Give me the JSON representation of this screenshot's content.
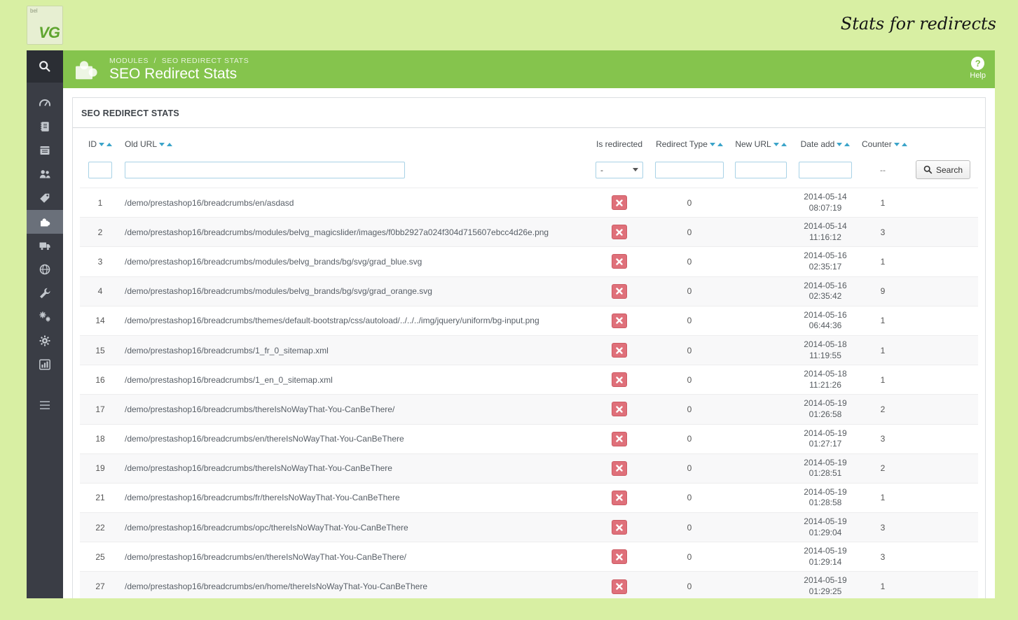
{
  "branding": {
    "logo_small": "bel",
    "logo_text": "VG",
    "tagline": "Stats for redirects"
  },
  "header": {
    "breadcrumb": [
      "MODULES",
      "SEO REDIRECT STATS"
    ],
    "breadcrumb_separator": "/",
    "title": "SEO Redirect Stats",
    "help": {
      "icon_glyph": "?",
      "label": "Help"
    }
  },
  "sidebar": {
    "items": [
      {
        "id": "search",
        "icon": "search-icon"
      },
      {
        "id": "dashboard",
        "icon": "dashboard-icon"
      },
      {
        "id": "orders",
        "icon": "orders-icon"
      },
      {
        "id": "catalog",
        "icon": "catalog-icon"
      },
      {
        "id": "customers",
        "icon": "customers-icon"
      },
      {
        "id": "price-rules",
        "icon": "tag-icon"
      },
      {
        "id": "modules",
        "icon": "puzzle-icon",
        "selected": true
      },
      {
        "id": "shipping",
        "icon": "truck-icon"
      },
      {
        "id": "localization",
        "icon": "globe-icon"
      },
      {
        "id": "preferences",
        "icon": "wrench-icon"
      },
      {
        "id": "advanced-parameters",
        "icon": "gears-icon"
      },
      {
        "id": "administration",
        "icon": "gear-icon"
      },
      {
        "id": "stats",
        "icon": "bar-chart-icon"
      },
      {
        "id": "menu-collapse",
        "icon": "hamburger-icon"
      }
    ]
  },
  "panel": {
    "title": "SEO REDIRECT STATS"
  },
  "table": {
    "columns": [
      {
        "label": "ID",
        "sortable": true
      },
      {
        "label": "Old URL",
        "sortable": true
      },
      {
        "label": "Is redirected",
        "sortable": false
      },
      {
        "label": "Redirect Type",
        "sortable": true
      },
      {
        "label": "New URL",
        "sortable": true
      },
      {
        "label": "Date add",
        "sortable": true
      },
      {
        "label": "Counter",
        "sortable": true
      }
    ],
    "filter": {
      "is_redirected_value": "-",
      "counter_placeholder": "--",
      "search_label": "Search"
    },
    "rows": [
      {
        "id": "1",
        "old_url": "/demo/prestashop16/breadcrumbs/en/asdasd",
        "is_redirected": false,
        "redirect_type": "0",
        "new_url": "",
        "date_add": "2014-05-14 08:07:19",
        "counter": "1"
      },
      {
        "id": "2",
        "old_url": "/demo/prestashop16/breadcrumbs/modules/belvg_magicslider/images/f0bb2927a024f304d715607ebcc4d26e.png",
        "is_redirected": false,
        "redirect_type": "0",
        "new_url": "",
        "date_add": "2014-05-14 11:16:12",
        "counter": "3"
      },
      {
        "id": "3",
        "old_url": "/demo/prestashop16/breadcrumbs/modules/belvg_brands/bg/svg/grad_blue.svg",
        "is_redirected": false,
        "redirect_type": "0",
        "new_url": "",
        "date_add": "2014-05-16 02:35:17",
        "counter": "1"
      },
      {
        "id": "4",
        "old_url": "/demo/prestashop16/breadcrumbs/modules/belvg_brands/bg/svg/grad_orange.svg",
        "is_redirected": false,
        "redirect_type": "0",
        "new_url": "",
        "date_add": "2014-05-16 02:35:42",
        "counter": "9"
      },
      {
        "id": "14",
        "old_url": "/demo/prestashop16/breadcrumbs/themes/default-bootstrap/css/autoload/../../../img/jquery/uniform/bg-input.png",
        "is_redirected": false,
        "redirect_type": "0",
        "new_url": "",
        "date_add": "2014-05-16 06:44:36",
        "counter": "1"
      },
      {
        "id": "15",
        "old_url": "/demo/prestashop16/breadcrumbs/1_fr_0_sitemap.xml",
        "is_redirected": false,
        "redirect_type": "0",
        "new_url": "",
        "date_add": "2014-05-18 11:19:55",
        "counter": "1"
      },
      {
        "id": "16",
        "old_url": "/demo/prestashop16/breadcrumbs/1_en_0_sitemap.xml",
        "is_redirected": false,
        "redirect_type": "0",
        "new_url": "",
        "date_add": "2014-05-18 11:21:26",
        "counter": "1"
      },
      {
        "id": "17",
        "old_url": "/demo/prestashop16/breadcrumbs/thereIsNoWayThat-You-CanBeThere/",
        "is_redirected": false,
        "redirect_type": "0",
        "new_url": "",
        "date_add": "2014-05-19 01:26:58",
        "counter": "2"
      },
      {
        "id": "18",
        "old_url": "/demo/prestashop16/breadcrumbs/en/thereIsNoWayThat-You-CanBeThere",
        "is_redirected": false,
        "redirect_type": "0",
        "new_url": "",
        "date_add": "2014-05-19 01:27:17",
        "counter": "3"
      },
      {
        "id": "19",
        "old_url": "/demo/prestashop16/breadcrumbs/thereIsNoWayThat-You-CanBeThere",
        "is_redirected": false,
        "redirect_type": "0",
        "new_url": "",
        "date_add": "2014-05-19 01:28:51",
        "counter": "2"
      },
      {
        "id": "21",
        "old_url": "/demo/prestashop16/breadcrumbs/fr/thereIsNoWayThat-You-CanBeThere",
        "is_redirected": false,
        "redirect_type": "0",
        "new_url": "",
        "date_add": "2014-05-19 01:28:58",
        "counter": "1"
      },
      {
        "id": "22",
        "old_url": "/demo/prestashop16/breadcrumbs/opc/thereIsNoWayThat-You-CanBeThere",
        "is_redirected": false,
        "redirect_type": "0",
        "new_url": "",
        "date_add": "2014-05-19 01:29:04",
        "counter": "3"
      },
      {
        "id": "25",
        "old_url": "/demo/prestashop16/breadcrumbs/en/thereIsNoWayThat-You-CanBeThere/",
        "is_redirected": false,
        "redirect_type": "0",
        "new_url": "",
        "date_add": "2014-05-19 01:29:14",
        "counter": "3"
      },
      {
        "id": "27",
        "old_url": "/demo/prestashop16/breadcrumbs/en/home/thereIsNoWayThat-You-CanBeThere",
        "is_redirected": false,
        "redirect_type": "0",
        "new_url": "",
        "date_add": "2014-05-19 01:29:25",
        "counter": "1"
      }
    ]
  }
}
